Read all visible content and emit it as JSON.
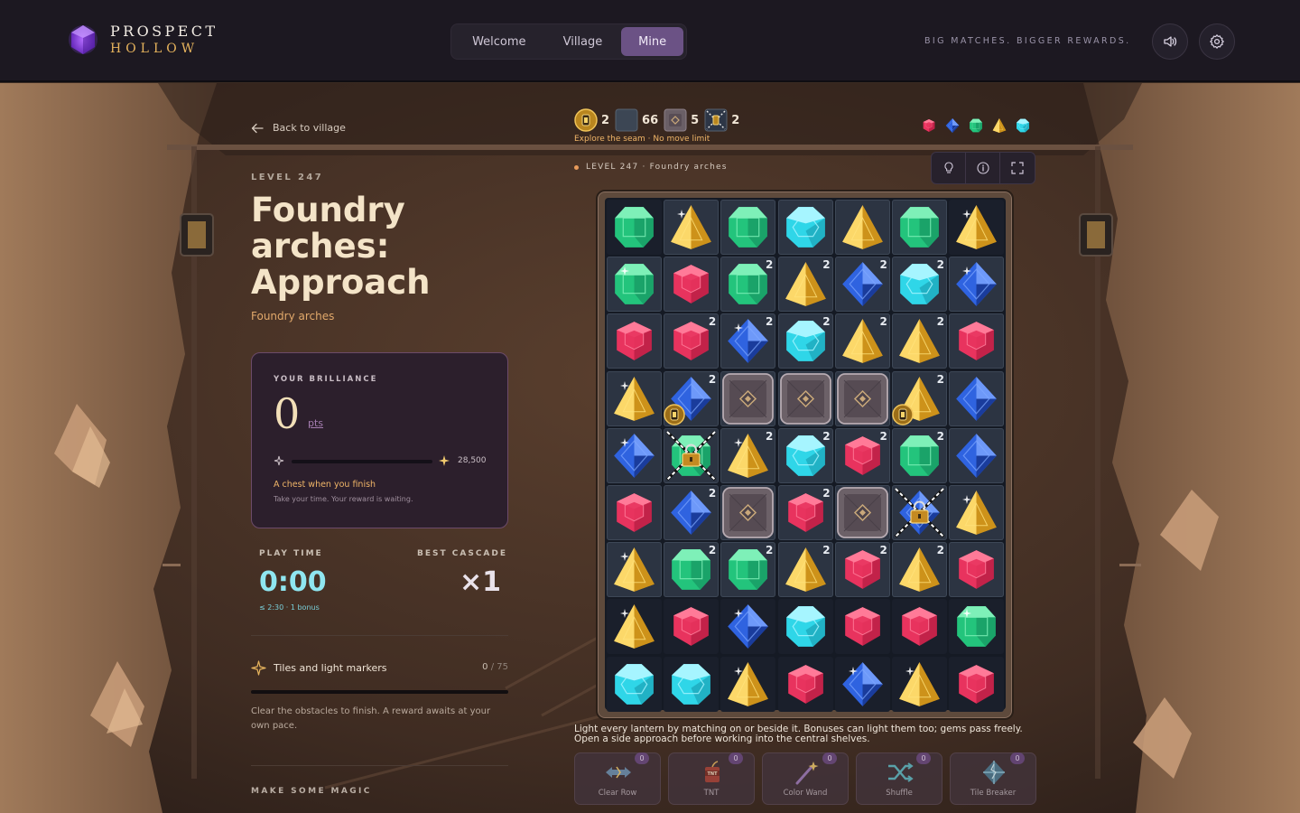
{
  "header": {
    "logo_line1": "PROSPECT",
    "logo_line2": "HOLLOW",
    "tabs": [
      {
        "label": "Welcome",
        "active": false
      },
      {
        "label": "Village",
        "active": false
      },
      {
        "label": "Mine",
        "active": true
      }
    ],
    "tagline": "BIG MATCHES. BIGGER REWARDS.",
    "sound_icon": "speaker-icon",
    "settings_icon": "gear-icon"
  },
  "left": {
    "back_label": "Back to village",
    "level_label": "LEVEL 247",
    "title": "Foundry arches: Approach",
    "subtitle": "Foundry arches",
    "brilliance": {
      "label": "YOUR BRILLIANCE",
      "value": "0",
      "unit": "pts",
      "progress": 0,
      "target": "28,500",
      "message": "A chest when you finish",
      "sub": "Take your time. Your reward is waiting."
    },
    "play_time_label": "PLAY TIME",
    "play_time": "0:00",
    "bonus_note": "≤ 2:30 · 1 bonus",
    "best_cascade_label": "BEST CASCADE",
    "best_cascade": "×1",
    "tiles_label": "Tiles and light markers",
    "tiles_done": "0",
    "tiles_total": "/ 75",
    "tiles_progress": 0,
    "tiles_desc": "Clear the obstacles to finish. A reward awaits at your own pace.",
    "magic_label": "MAKE SOME MAGIC"
  },
  "goals": {
    "items": [
      {
        "icon": "lantern-icon",
        "count": "2"
      },
      {
        "icon": "tile-icon",
        "count": "66"
      },
      {
        "icon": "stone-block-icon",
        "count": "5"
      },
      {
        "icon": "locked-lantern-icon",
        "count": "2"
      }
    ],
    "note": "Explore the seam · No move limit"
  },
  "gem_types": [
    "red",
    "blue",
    "green",
    "yellow",
    "cyan"
  ],
  "level_line": "LEVEL 247 · Foundry arches",
  "tools": [
    "lightbulb-icon",
    "info-icon",
    "fullscreen-icon"
  ],
  "board": {
    "rows": 9,
    "cols": 7,
    "grid": [
      [
        "G",
        "Y",
        "G",
        "C",
        "Y",
        "G",
        "Y"
      ],
      [
        "G",
        "R",
        "G",
        "Y",
        "B",
        "C",
        "B"
      ],
      [
        "R",
        "R",
        "B",
        "C",
        "Y",
        "Y",
        "R"
      ],
      [
        "Y",
        "B",
        "S",
        "S",
        "S",
        "Y",
        "B"
      ],
      [
        "B",
        "G",
        "Y",
        "C",
        "R",
        "G",
        "B"
      ],
      [
        "R",
        "B",
        "S",
        "R",
        "S",
        "B",
        "Y"
      ],
      [
        "Y",
        "G",
        "G",
        "Y",
        "R",
        "Y",
        "R"
      ],
      [
        "Y",
        "R",
        "B",
        "C",
        "R",
        "R",
        "G"
      ],
      [
        "C",
        "C",
        "Y",
        "R",
        "B",
        "Y",
        "R"
      ]
    ],
    "tiled": [
      [
        0,
        1,
        1,
        1,
        1,
        1,
        0
      ],
      [
        1,
        1,
        1,
        1,
        1,
        1,
        1
      ],
      [
        1,
        1,
        1,
        1,
        1,
        1,
        1
      ],
      [
        1,
        1,
        1,
        1,
        1,
        1,
        1
      ],
      [
        1,
        1,
        1,
        1,
        1,
        1,
        1
      ],
      [
        1,
        1,
        1,
        1,
        1,
        1,
        1
      ],
      [
        1,
        1,
        1,
        1,
        1,
        1,
        1
      ],
      [
        0,
        0,
        0,
        0,
        0,
        0,
        0
      ],
      [
        0,
        0,
        0,
        0,
        0,
        0,
        0
      ]
    ],
    "double": [
      [
        0,
        0,
        0,
        0,
        0,
        0,
        0
      ],
      [
        0,
        0,
        1,
        1,
        1,
        1,
        0
      ],
      [
        0,
        1,
        1,
        1,
        1,
        1,
        0
      ],
      [
        0,
        1,
        0,
        0,
        0,
        1,
        0
      ],
      [
        0,
        0,
        1,
        1,
        1,
        1,
        0
      ],
      [
        0,
        1,
        0,
        1,
        0,
        0,
        0
      ],
      [
        0,
        1,
        1,
        1,
        1,
        1,
        0
      ],
      [
        0,
        0,
        0,
        0,
        0,
        0,
        0
      ],
      [
        0,
        0,
        0,
        0,
        0,
        0,
        0
      ]
    ],
    "lanterns": [
      [
        3,
        1
      ],
      [
        3,
        5
      ]
    ],
    "locked": [
      [
        4,
        1
      ],
      [
        5,
        5
      ]
    ],
    "sparkle": [
      [
        0,
        1
      ],
      [
        0,
        6
      ],
      [
        1,
        0
      ],
      [
        1,
        6
      ],
      [
        2,
        2
      ],
      [
        3,
        0
      ],
      [
        4,
        0
      ],
      [
        4,
        2
      ],
      [
        5,
        6
      ],
      [
        6,
        0
      ],
      [
        7,
        0
      ],
      [
        7,
        2
      ],
      [
        7,
        6
      ],
      [
        8,
        2
      ],
      [
        8,
        4
      ],
      [
        8,
        5
      ]
    ]
  },
  "hint": "Light every lantern by matching on or beside it. Bonuses can light them too; gems pass freely. Open a side approach before working into the central shelves.",
  "boosters": [
    {
      "label": "Clear Row",
      "count": "0",
      "icon": "clear-row-icon"
    },
    {
      "label": "TNT",
      "count": "0",
      "icon": "tnt-icon"
    },
    {
      "label": "Color Wand",
      "count": "0",
      "icon": "wand-icon"
    },
    {
      "label": "Shuffle",
      "count": "0",
      "icon": "shuffle-icon"
    },
    {
      "label": "Tile Breaker",
      "count": "0",
      "icon": "tile-breaker-icon"
    }
  ],
  "colors": {
    "red": "#e8335e",
    "blue": "#2f63e0",
    "green": "#23c47c",
    "yellow": "#f0b127",
    "cyan": "#2fd6e8",
    "accent": "#6b5285"
  }
}
